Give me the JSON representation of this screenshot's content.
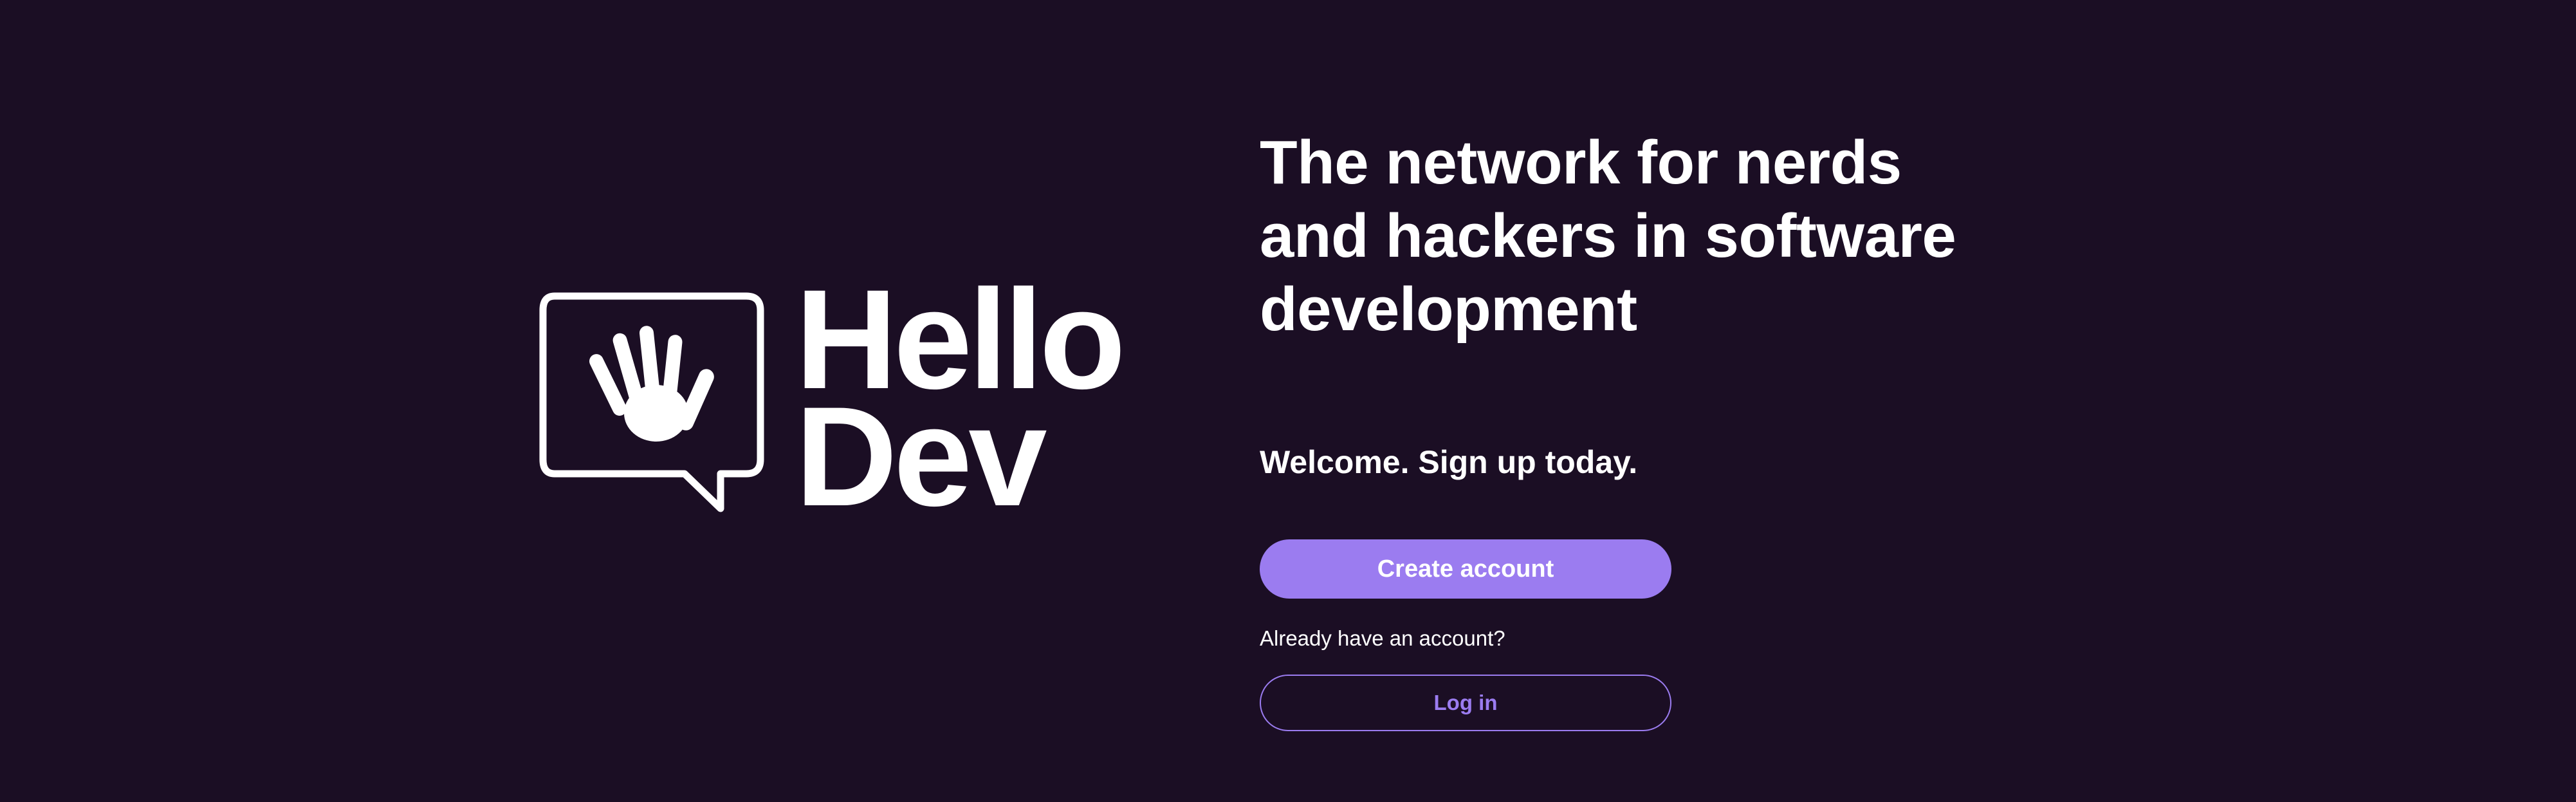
{
  "brand": {
    "logo_icon": "waving-hand-speech-bubble-icon",
    "name_line1": "Hello",
    "name_line2": "Dev"
  },
  "hero": {
    "headline_line1": "The network for nerds",
    "headline_line2": "and hackers in software",
    "headline_line3": "development"
  },
  "signup": {
    "welcome_text": "Welcome. Sign up today.",
    "create_account_label": "Create account",
    "already_text": "Already have an account?",
    "login_label": "Log in"
  },
  "colors": {
    "background": "#1b0e24",
    "accent": "#9b7cf0",
    "text": "#ffffff"
  }
}
